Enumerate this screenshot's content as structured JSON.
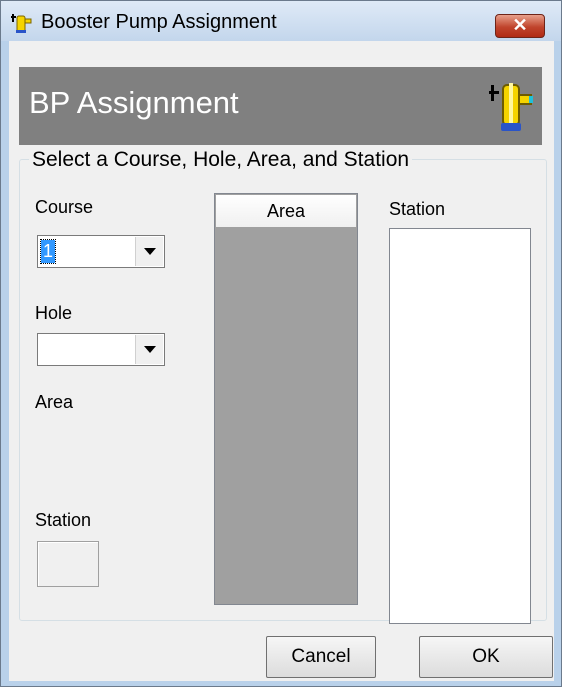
{
  "window": {
    "title": "Booster Pump Assignment",
    "close_glyph": "✕",
    "icon": "booster-pump-icon"
  },
  "header": {
    "title": "BP Assignment",
    "icon": "booster-pump-icon"
  },
  "group": {
    "legend": "Select a Course, Hole, Area, and Station"
  },
  "course": {
    "label": "Course",
    "value": "1"
  },
  "hole": {
    "label": "Hole",
    "value": ""
  },
  "area_label": "Area",
  "station_label": "Station",
  "area_list": {
    "header": "Area"
  },
  "station_list": {
    "label": "Station"
  },
  "buttons": {
    "cancel": "Cancel",
    "ok": "OK"
  },
  "colors": {
    "header_band": "#808080",
    "selection": "#3399ff",
    "close_button": "#c0442c"
  }
}
